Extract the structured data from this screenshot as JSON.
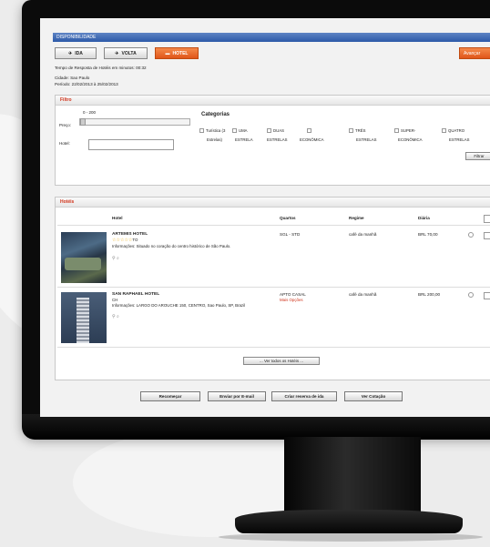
{
  "window": {
    "title": "DISPONIBILIDADE"
  },
  "tabs": [
    {
      "label": "IDA",
      "icon": "plane-icon"
    },
    {
      "label": "VOLTA",
      "icon": "plane-icon"
    },
    {
      "label": "HOTEL",
      "icon": "bed-icon"
    }
  ],
  "advance_label": "Avançar",
  "info": {
    "response_time": "Tempo de Resposta de Hotéis em minutos: 00:32",
    "city": "Cidade: Sao Paulo",
    "period": "Período:  22/02/2013  à  25/02/2013"
  },
  "filter": {
    "title": "Filtro",
    "price_range": "0 - 200",
    "price_label": "Preço:",
    "hotel_label": "Hotel:",
    "categories_title": "Categorias",
    "categories": [
      {
        "line1": "Turística (3",
        "line2": "Estrelas)"
      },
      {
        "line1": "UMA",
        "line2": "ESTRELA"
      },
      {
        "line1": "DUAS",
        "line2": "ESTRELAS"
      },
      {
        "line1": "",
        "line2": "ECONÔMICA"
      },
      {
        "line1": "TRÊS",
        "line2": "ESTRELAS"
      },
      {
        "line1": "SUPER-",
        "line2": "ECONÔMICA"
      },
      {
        "line1": "QUATRO",
        "line2": "ESTRELAS"
      }
    ],
    "filter_button": "Filtrar"
  },
  "hotels": {
    "title": "Hotéis",
    "columns": [
      "Hotel",
      "Quartos",
      "Regime",
      "Diária"
    ],
    "rows": [
      {
        "name": "ARTEMIS HOTEL",
        "stars": "☆☆☆☆☆",
        "stars_suffix": "TO",
        "info": "Informações: Situado no coração do centro histórico de São Paulo.",
        "room": "SGL - STD",
        "room_link": "",
        "regime": "café da manhã",
        "price": "BRL 70,00"
      },
      {
        "name": "SAN RAPHAEL HOTEL",
        "stars": "",
        "stars_suffix": "CH",
        "info": "Informações: LARGO DO AROUCHE 150, CENTRO, Sao Paulo, SP, Brazil",
        "room": "APTO CASAL",
        "room_link": "Mais Opções",
        "regime": "café da manhã",
        "price": "BRL 200,00"
      }
    ],
    "see_all": "... Ver todos os Hotéis ..."
  },
  "bottom_buttons": [
    "Recomeçar",
    "Enviar por E-mail",
    "Criar reserva de ida",
    "Ver Cotação"
  ],
  "colors": {
    "accent": "#e0561a",
    "titlebar": "#2d5aa8",
    "section_title": "#d0331a"
  }
}
